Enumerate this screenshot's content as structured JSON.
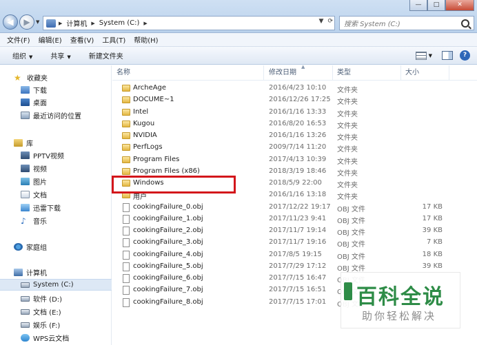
{
  "window": {
    "minimize_label": "—",
    "maximize_label": "□",
    "close_label": "✕"
  },
  "address": {
    "segments": [
      "计算机",
      "System (C:)"
    ],
    "search_placeholder": "搜索 System (C:)"
  },
  "menu": [
    "文件(F)",
    "编辑(E)",
    "查看(V)",
    "工具(T)",
    "帮助(H)"
  ],
  "toolbar": {
    "organize": "组织",
    "share": "共享",
    "new_folder": "新建文件夹"
  },
  "sidebar": {
    "favorites": {
      "label": "收藏夹",
      "items": [
        "下载",
        "桌面",
        "最近访问的位置"
      ]
    },
    "libraries": {
      "label": "库",
      "items": [
        "PPTV视频",
        "视频",
        "图片",
        "文档",
        "迅雷下载",
        "音乐"
      ]
    },
    "homegroup": "家庭组",
    "computer": {
      "label": "计算机",
      "items": [
        "System (C:)",
        "软件 (D:)",
        "文档 (E:)",
        "娱乐 (F:)",
        "WPS云文档"
      ],
      "selected": "System (C:)"
    }
  },
  "columns": {
    "name": "名称",
    "date": "修改日期",
    "type": "类型",
    "size": "大小"
  },
  "files": [
    {
      "name": "ArcheAge",
      "date": "2016/4/23 10:10",
      "type": "文件夹",
      "size": "",
      "kind": "folder"
    },
    {
      "name": "DOCUME~1",
      "date": "2016/12/26 17:25",
      "type": "文件夹",
      "size": "",
      "kind": "folder"
    },
    {
      "name": "Intel",
      "date": "2016/1/16 13:33",
      "type": "文件夹",
      "size": "",
      "kind": "folder"
    },
    {
      "name": "Kugou",
      "date": "2016/8/20 16:53",
      "type": "文件夹",
      "size": "",
      "kind": "folder"
    },
    {
      "name": "NVIDIA",
      "date": "2016/1/16 13:26",
      "type": "文件夹",
      "size": "",
      "kind": "folder"
    },
    {
      "name": "PerfLogs",
      "date": "2009/7/14 11:20",
      "type": "文件夹",
      "size": "",
      "kind": "folder"
    },
    {
      "name": "Program Files",
      "date": "2017/4/13 10:39",
      "type": "文件夹",
      "size": "",
      "kind": "folder"
    },
    {
      "name": "Program Files (x86)",
      "date": "2018/3/19 18:46",
      "type": "文件夹",
      "size": "",
      "kind": "folder"
    },
    {
      "name": "Windows",
      "date": "2018/5/9 22:00",
      "type": "文件夹",
      "size": "",
      "kind": "folder"
    },
    {
      "name": "用户",
      "date": "2016/1/16 13:18",
      "type": "文件夹",
      "size": "",
      "kind": "folder"
    },
    {
      "name": "cookingFailure_0.obj",
      "date": "2017/12/22 19:17",
      "type": "OBJ 文件",
      "size": "17 KB",
      "kind": "file"
    },
    {
      "name": "cookingFailure_1.obj",
      "date": "2017/11/23 9:41",
      "type": "OBJ 文件",
      "size": "17 KB",
      "kind": "file"
    },
    {
      "name": "cookingFailure_2.obj",
      "date": "2017/11/7 19:14",
      "type": "OBJ 文件",
      "size": "39 KB",
      "kind": "file"
    },
    {
      "name": "cookingFailure_3.obj",
      "date": "2017/11/7 19:16",
      "type": "OBJ 文件",
      "size": "7 KB",
      "kind": "file"
    },
    {
      "name": "cookingFailure_4.obj",
      "date": "2017/8/5 19:15",
      "type": "OBJ 文件",
      "size": "18 KB",
      "kind": "file"
    },
    {
      "name": "cookingFailure_5.obj",
      "date": "2017/7/29 17:12",
      "type": "OBJ 文件",
      "size": "39 KB",
      "kind": "file"
    },
    {
      "name": "cookingFailure_6.obj",
      "date": "2017/7/15 16:47",
      "type": "OBJ 文件",
      "size": "",
      "kind": "file"
    },
    {
      "name": "cookingFailure_7.obj",
      "date": "2017/7/15 16:51",
      "type": "OBJ 文件",
      "size": "",
      "kind": "file"
    },
    {
      "name": "cookingFailure_8.obj",
      "date": "2017/7/15 17:01",
      "type": "OBJ 文件",
      "size": "",
      "kind": "file"
    }
  ],
  "highlighted_file": "Windows",
  "watermark": {
    "title": "百科全说",
    "subtitle": "助你轻松解决",
    "color": "#2e8c47"
  }
}
